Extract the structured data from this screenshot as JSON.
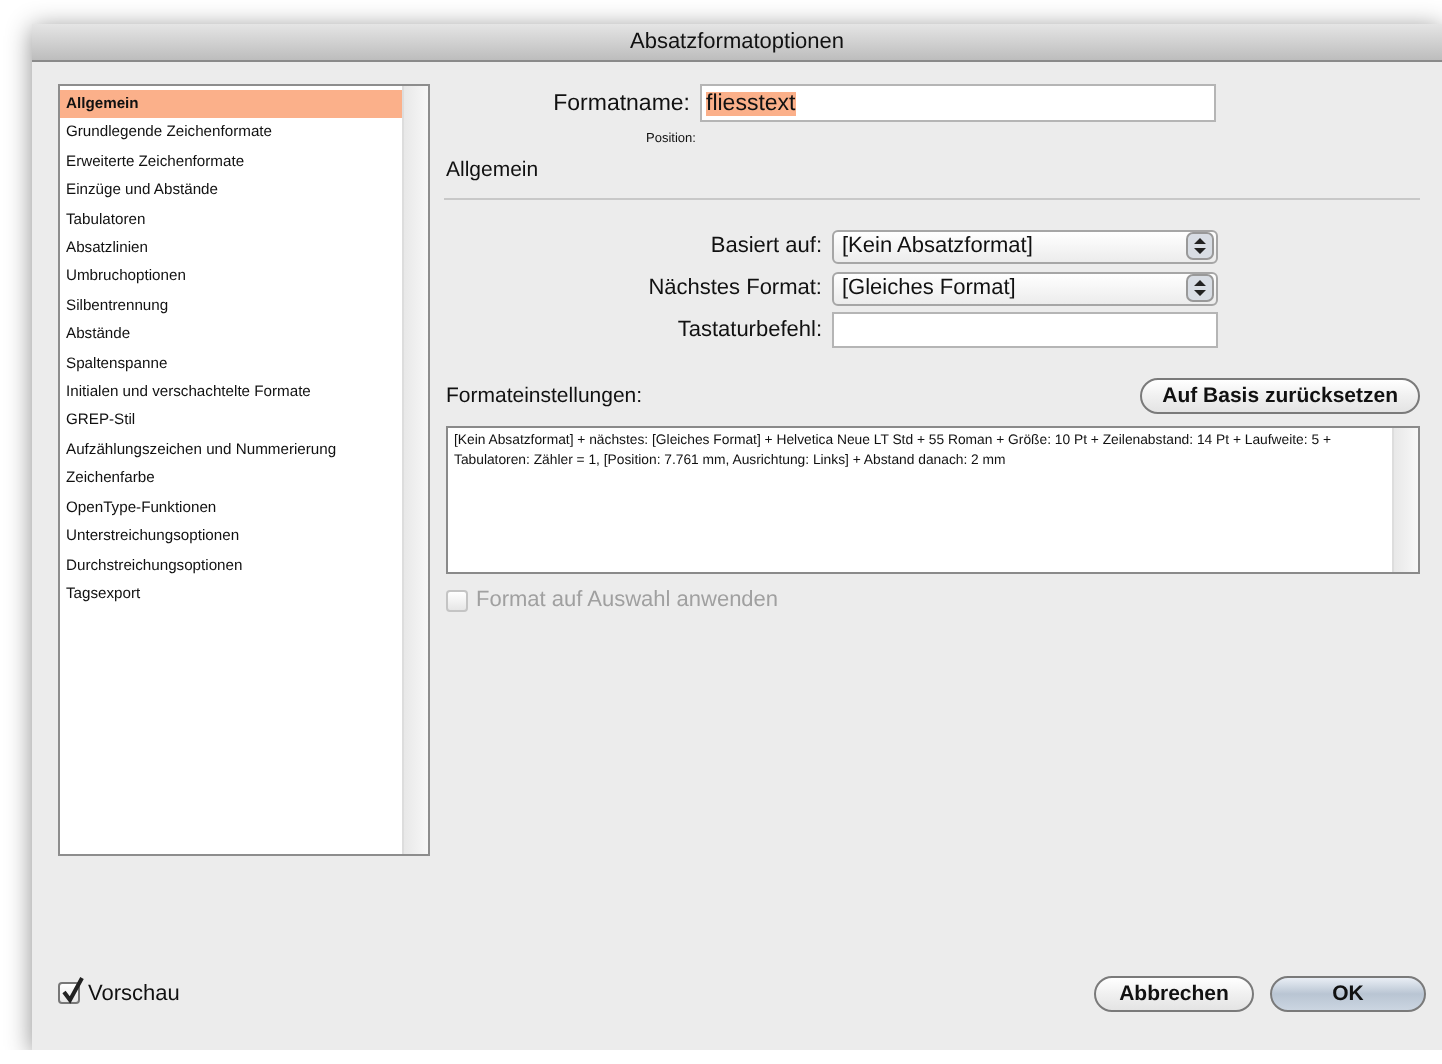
{
  "window": {
    "title": "Absatzformatoptionen"
  },
  "sidebar": {
    "items": [
      {
        "label": "Allgemein",
        "selected": true
      },
      {
        "label": "Grundlegende Zeichenformate",
        "selected": false
      },
      {
        "label": "Erweiterte Zeichenformate",
        "selected": false
      },
      {
        "label": "Einzüge und Abstände",
        "selected": false
      },
      {
        "label": "Tabulatoren",
        "selected": false
      },
      {
        "label": "Absatzlinien",
        "selected": false
      },
      {
        "label": "Umbruchoptionen",
        "selected": false
      },
      {
        "label": "Silbentrennung",
        "selected": false
      },
      {
        "label": "Abstände",
        "selected": false
      },
      {
        "label": "Spaltenspanne",
        "selected": false
      },
      {
        "label": "Initialen und verschachtelte Formate",
        "selected": false
      },
      {
        "label": "GREP-Stil",
        "selected": false
      },
      {
        "label": "Aufzählungszeichen und Nummerierung",
        "selected": false
      },
      {
        "label": "Zeichenfarbe",
        "selected": false
      },
      {
        "label": "OpenType-Funktionen",
        "selected": false
      },
      {
        "label": "Unterstreichungsoptionen",
        "selected": false
      },
      {
        "label": "Durchstreichungsoptionen",
        "selected": false
      },
      {
        "label": "Tagsexport",
        "selected": false
      }
    ]
  },
  "format_name": {
    "label": "Formatname:",
    "value": "fliesstext"
  },
  "position_label": "Position:",
  "section_title": "Allgemein",
  "fields": [
    {
      "kind": "select",
      "label": "Basiert auf:",
      "value": "[Kein Absatzformat]"
    },
    {
      "kind": "select",
      "label": "Nächstes Format:",
      "value": "[Gleiches Format]"
    },
    {
      "kind": "text",
      "label": "Tastaturbefehl:"
    }
  ],
  "settings": {
    "label": "Formateinstellungen:",
    "reset_button": "Auf Basis zurücksetzen",
    "text": "[Kein Absatzformat] + nächstes: [Gleiches Format] + Helvetica Neue LT Std + 55 Roman + Größe: 10 Pt + Zeilenabstand: 14 Pt + Laufweite: 5 + Tabulatoren: Zähler = 1, [Position: 7.761 mm, Ausrichtung: Links]  + Abstand danach: 2 mm"
  },
  "apply_checkbox": {
    "label": "Format auf Auswahl anwenden",
    "checked": false,
    "disabled": true
  },
  "preview_checkbox": {
    "label": "Vorschau",
    "checked": true,
    "disabled": false
  },
  "buttons": [
    {
      "label": "Abbrechen",
      "default": false
    },
    {
      "label": "OK",
      "default": true
    }
  ]
}
